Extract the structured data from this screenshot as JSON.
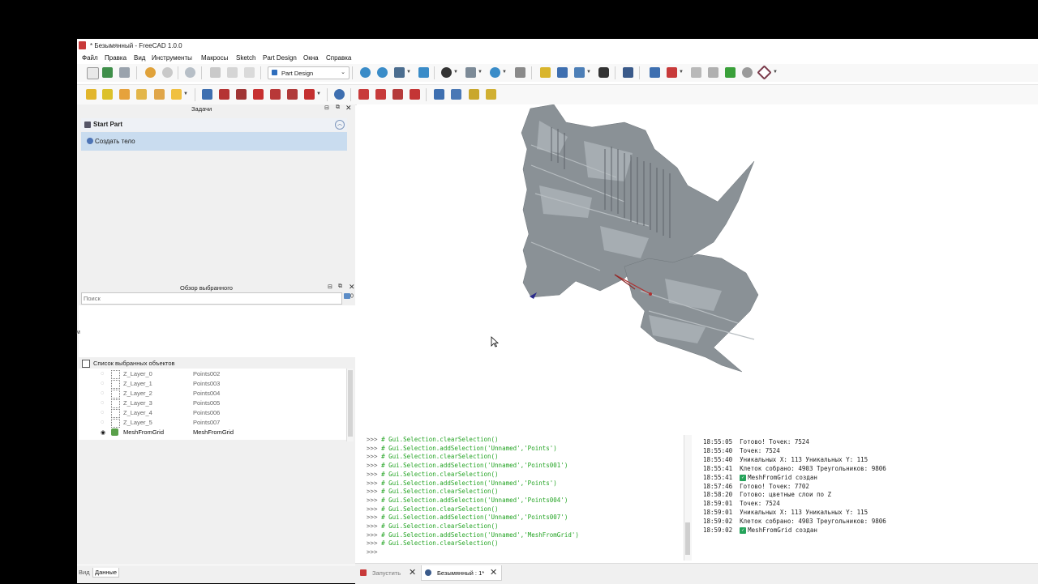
{
  "window": {
    "title": "* Безымянный - FreeCAD 1.0.0"
  },
  "menu": [
    "Файл",
    "Правка",
    "Вид",
    "Инструменты",
    "Макросы",
    "Sketch",
    "Part Design",
    "Окна",
    "Справка"
  ],
  "toolbar": {
    "workbench": "Part Design"
  },
  "tasks_panel": {
    "header": "Задачи",
    "section_title": "Start Part",
    "action": "Создать тело"
  },
  "selection_view": {
    "header": "Обзор выбранного",
    "search_placeholder": "Поиск",
    "count": "0",
    "list_checkbox_label": "Список выбранных объектов",
    "left_edge_char": "м"
  },
  "objects": [
    {
      "name": "Z_Layer_0",
      "label": "Points002"
    },
    {
      "name": "Z_Layer_1",
      "label": "Points003"
    },
    {
      "name": "Z_Layer_2",
      "label": "Points004"
    },
    {
      "name": "Z_Layer_3",
      "label": "Points005"
    },
    {
      "name": "Z_Layer_4",
      "label": "Points006"
    },
    {
      "name": "Z_Layer_5",
      "label": "Points007"
    },
    {
      "name": "MeshFromGrid",
      "label": "MeshFromGrid"
    }
  ],
  "bottom_tabs": [
    "Вид",
    "Данные"
  ],
  "console": {
    "prompt": ">>>",
    "lines": [
      "# Gui.Selection.clearSelection()",
      "# Gui.Selection.addSelection('Unnamed','Points')",
      "# Gui.Selection.clearSelection()",
      "# Gui.Selection.addSelection('Unnamed','Points001')",
      "# Gui.Selection.clearSelection()",
      "# Gui.Selection.addSelection('Unnamed','Points')",
      "# Gui.Selection.clearSelection()",
      "# Gui.Selection.addSelection('Unnamed','Points004')",
      "# Gui.Selection.clearSelection()",
      "# Gui.Selection.addSelection('Unnamed','Points007')",
      "# Gui.Selection.clearSelection()",
      "# Gui.Selection.addSelection('Unnamed','MeshFromGrid')",
      "# Gui.Selection.clearSelection()",
      ""
    ]
  },
  "report": [
    {
      "time": "18:55:05",
      "text": "Готово! Точек: 7524",
      "check": false
    },
    {
      "time": "18:55:40",
      "text": "Точек: 7524",
      "check": false
    },
    {
      "time": "18:55:40",
      "text": "Уникальных X: 113 Уникальных Y: 115",
      "check": false
    },
    {
      "time": "18:55:41",
      "text": "Клеток собрано: 4903 Треугольников: 9806",
      "check": false
    },
    {
      "time": "18:55:41",
      "text": "MeshFromGrid создан",
      "check": true
    },
    {
      "time": "18:57:46",
      "text": "Готово! Точек: 7702",
      "check": false
    },
    {
      "time": "18:58:20",
      "text": "Готово: цветные слои по Z",
      "check": false
    },
    {
      "time": "18:59:01",
      "text": "Точек: 7524",
      "check": false
    },
    {
      "time": "18:59:01",
      "text": "Уникальных X: 113 Уникальных Y: 115",
      "check": false
    },
    {
      "time": "18:59:02",
      "text": "Клеток собрано: 4903 Треугольников: 9806",
      "check": false
    },
    {
      "time": "18:59:02",
      "text": "MeshFromGrid создан",
      "check": true
    }
  ],
  "doc_tabs": [
    "Запустить",
    "Безымянный : 1*"
  ],
  "colors": {
    "accent": "#c9dcef",
    "console_cmd": "#24a424",
    "mesh": "#8a9196"
  }
}
